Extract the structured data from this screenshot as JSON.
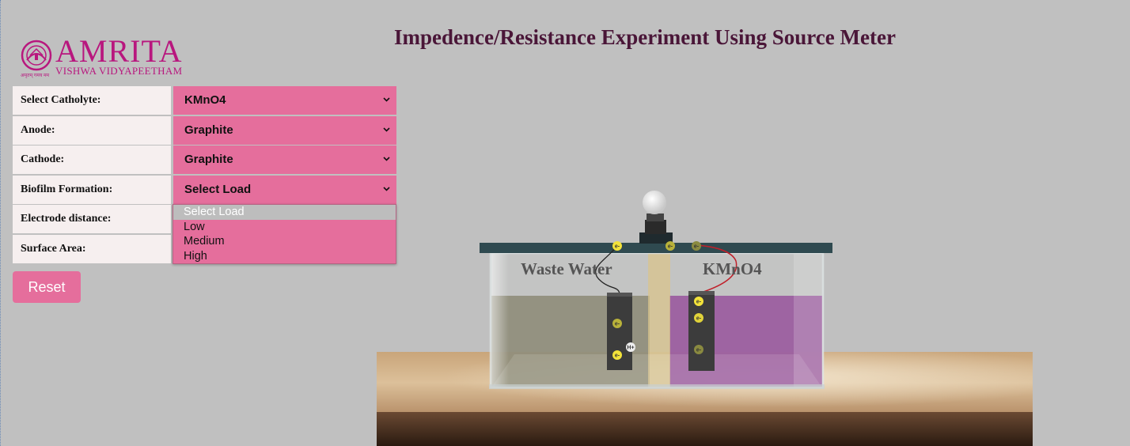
{
  "header": {
    "title": "Impedence/Resistance Experiment Using Source Meter"
  },
  "logo": {
    "name": "AMRITA",
    "subtitle": "VISHWA VIDYAPEETHAM",
    "tagline": "अमृतम् गमय मम"
  },
  "form": {
    "rows": [
      {
        "label": "Select Catholyte:",
        "value": "KMnO4"
      },
      {
        "label": "Anode:",
        "value": "Graphite"
      },
      {
        "label": "Cathode:",
        "value": "Graphite"
      },
      {
        "label": "Biofilm Formation:",
        "value": "Select Load"
      },
      {
        "label": "Electrode distance:",
        "value": ""
      },
      {
        "label": "Surface Area:",
        "value": ""
      }
    ]
  },
  "dropdown": {
    "options": [
      "Select Load",
      "Low",
      "Medium",
      "High"
    ],
    "highlighted": "Select Load"
  },
  "buttons": {
    "reset": "Reset"
  },
  "scene": {
    "left_chamber_label": "Waste Water",
    "right_chamber_label": "KMnO4",
    "electron_label": "e-",
    "proton_label": "H+"
  },
  "colors": {
    "accent": "#e56e9c",
    "title": "#4a1638",
    "brand": "#b8177e",
    "catholyte": "#9a5a9e",
    "wastewater": "#8c8a75"
  },
  "icons": [
    "chevron-down-icon",
    "bulb-icon",
    "amrita-emblem-icon"
  ]
}
